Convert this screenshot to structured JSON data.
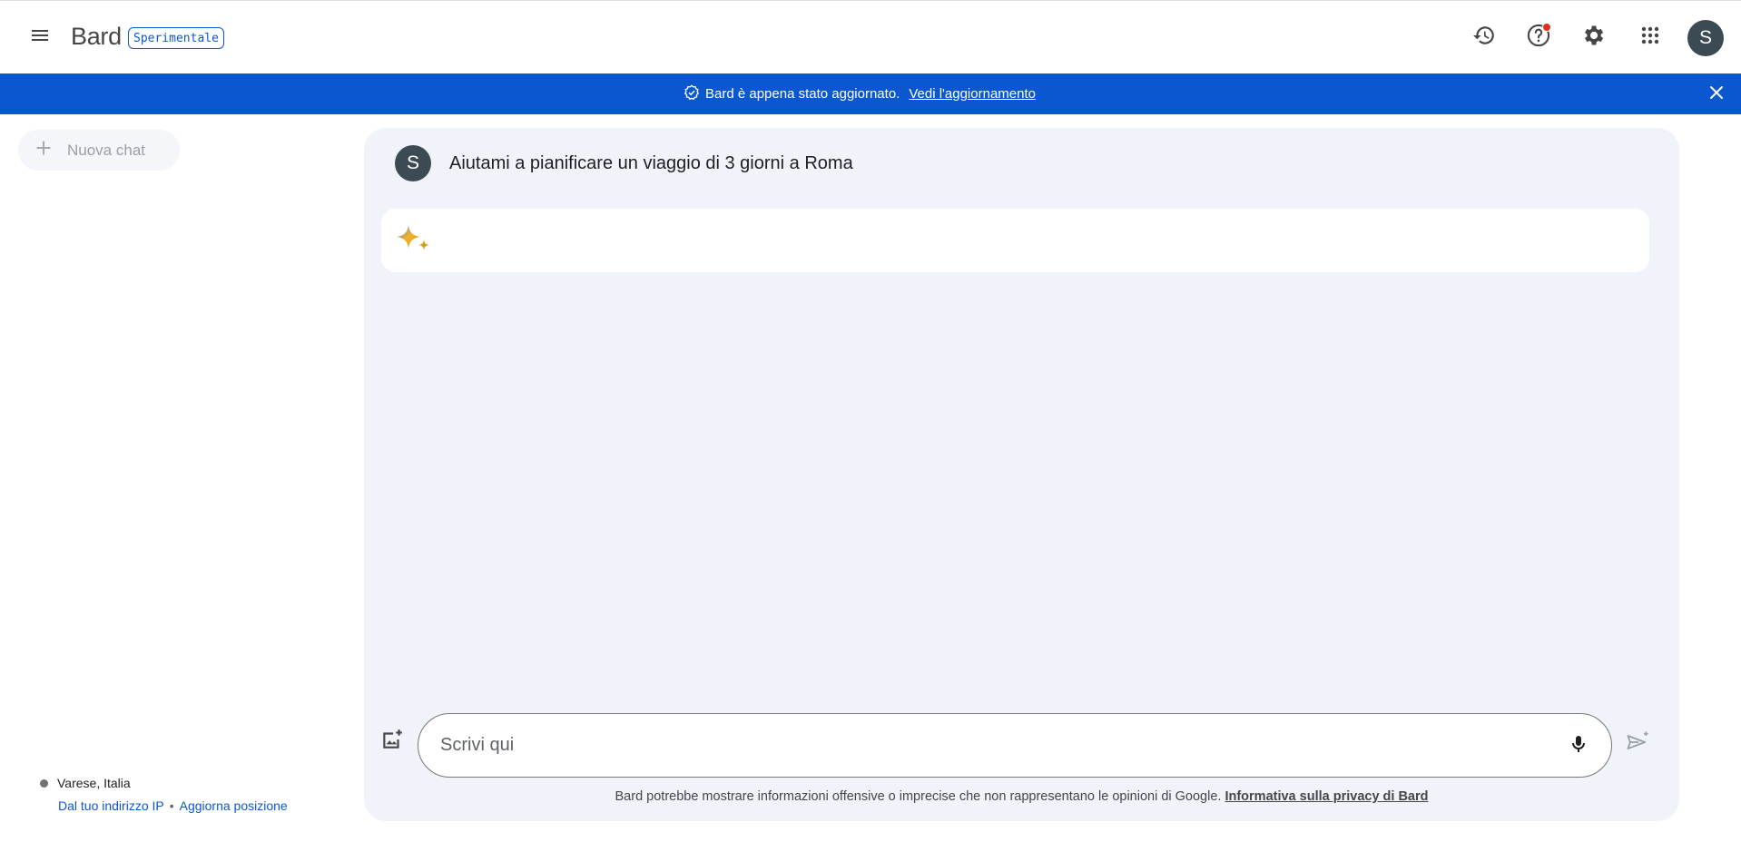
{
  "header": {
    "logo": "Bard",
    "badge": "Sperimentale",
    "avatar_initial": "S",
    "icons": [
      "menu-icon",
      "history-icon",
      "help-icon",
      "settings-icon",
      "apps-icon"
    ]
  },
  "banner": {
    "text": "Bard è appena stato aggiornato.",
    "link": "Vedi l'aggiornamento"
  },
  "sidebar": {
    "new_chat_label": "Nuova chat",
    "location": {
      "place": "Varese, Italia",
      "source": "Dal tuo indirizzo IP",
      "separator": "•",
      "update_link": "Aggiorna posizione"
    }
  },
  "conversation": {
    "user_initial": "S",
    "user_message": "Aiutami a pianificare un viaggio di 3 giorni a Roma"
  },
  "composer": {
    "placeholder": "Scrivi qui"
  },
  "footer": {
    "disclaimer": "Bard potrebbe mostrare informazioni offensive o imprecise che non rappresentano le opinioni di Google.",
    "privacy_link": "Informativa sulla privacy di Bard"
  },
  "colors": {
    "accent": "#0b57d0",
    "panel_bg": "#f0f4fa",
    "avatar_bg": "#3c4a53",
    "notification": "#d93025"
  }
}
